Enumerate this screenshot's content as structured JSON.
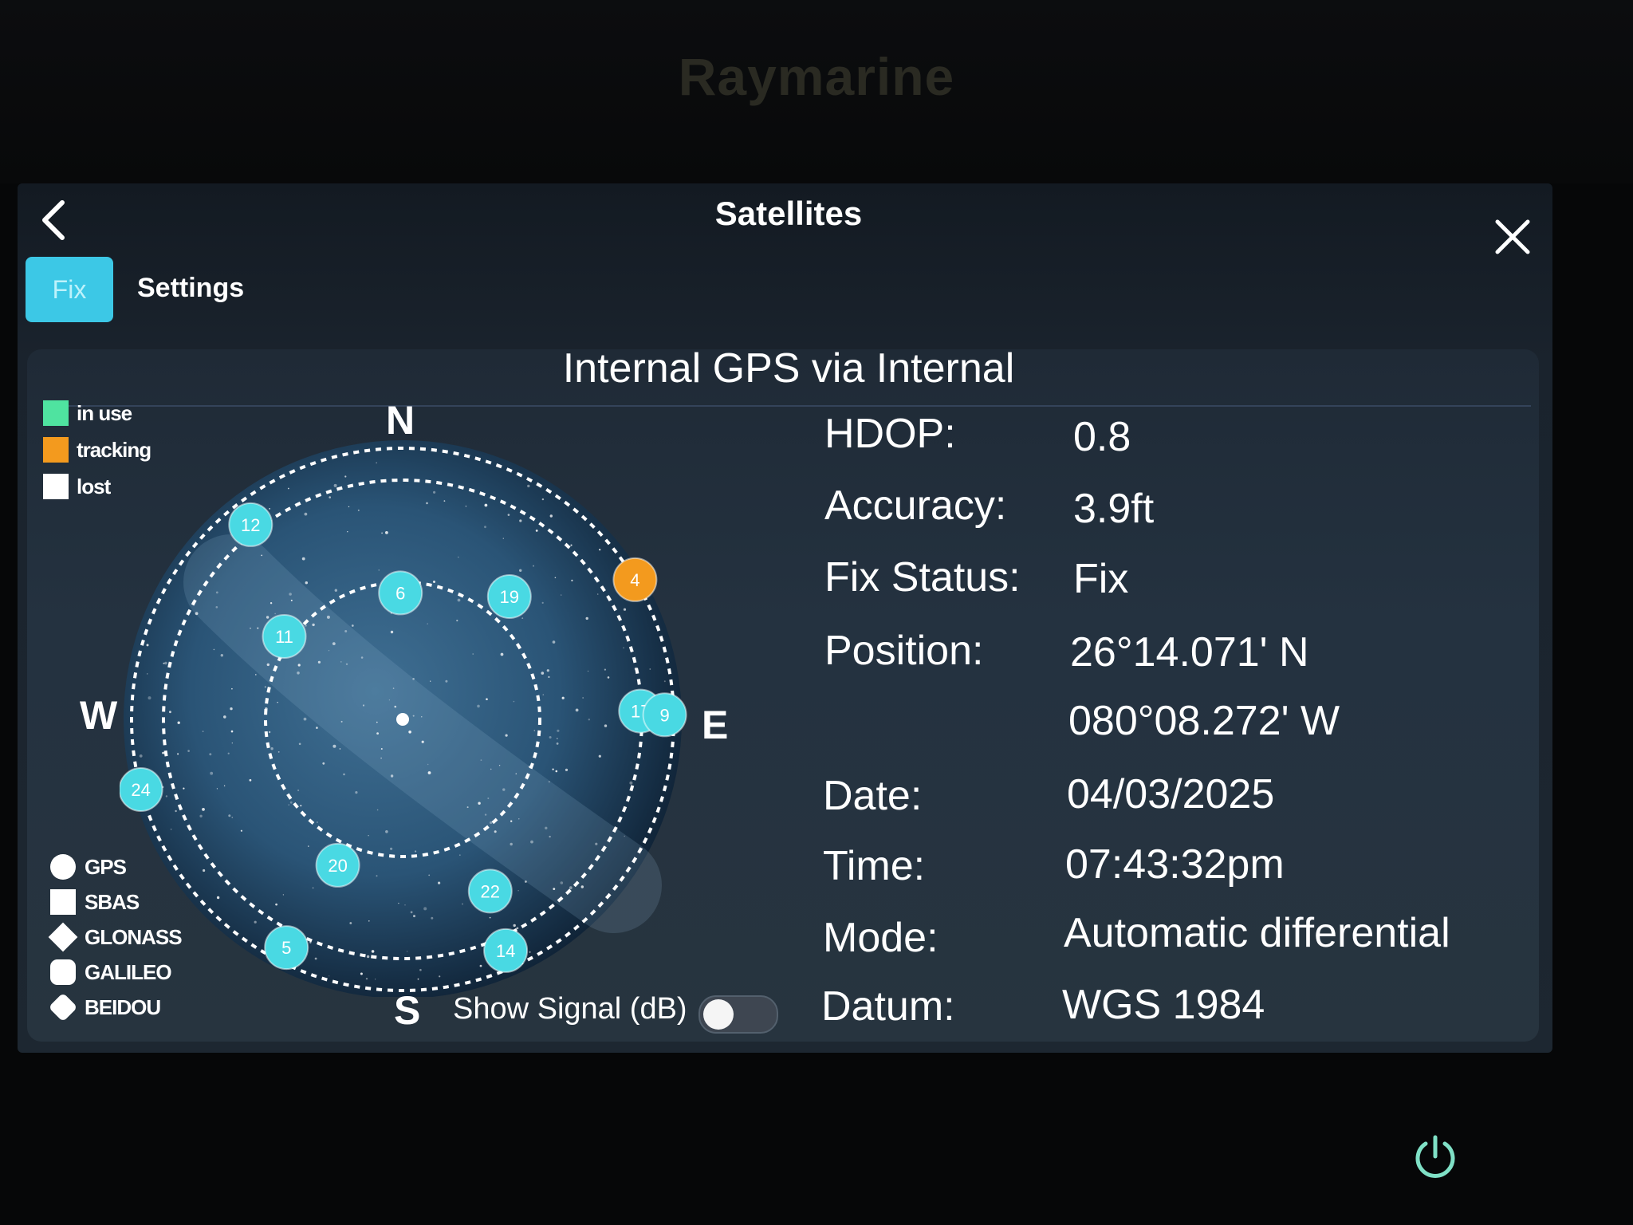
{
  "device": {
    "brand": "Raymarine"
  },
  "header": {
    "title": "Satellites"
  },
  "tabs": [
    {
      "label": "Fix",
      "active": true
    },
    {
      "label": "Settings",
      "active": false
    }
  ],
  "panel": {
    "title": "Internal GPS via Internal"
  },
  "legend": [
    {
      "label": "in use",
      "color": "#4fe3a0"
    },
    {
      "label": "tracking",
      "color": "#f39a1e"
    },
    {
      "label": "lost",
      "color": "#ffffff"
    }
  ],
  "compass": {
    "n": "N",
    "e": "E",
    "s": "S",
    "w": "W"
  },
  "satellites": [
    {
      "id": "12",
      "status": "in use",
      "color": "#49d9e3",
      "az": 322,
      "el": 8
    },
    {
      "id": "6",
      "status": "in use",
      "color": "#49d9e3",
      "az": 359,
      "el": 48
    },
    {
      "id": "4",
      "status": "tracking",
      "color": "#f39a1e",
      "az": 59,
      "el": 0
    },
    {
      "id": "19",
      "status": "in use",
      "color": "#49d9e3",
      "az": 41,
      "el": 36
    },
    {
      "id": "11",
      "status": "in use",
      "color": "#49d9e3",
      "az": 305,
      "el": 42
    },
    {
      "id": "17",
      "status": "in use",
      "color": "#49d9e3",
      "az": 88,
      "el": 11
    },
    {
      "id": "9",
      "status": "in use",
      "color": "#49d9e3",
      "az": 89,
      "el": 3
    },
    {
      "id": "24",
      "status": "in use",
      "color": "#49d9e3",
      "az": 255,
      "el": 0
    },
    {
      "id": "20",
      "status": "in use",
      "color": "#49d9e3",
      "az": 204,
      "el": 37
    },
    {
      "id": "22",
      "status": "in use",
      "color": "#49d9e3",
      "az": 153,
      "el": 26
    },
    {
      "id": "5",
      "status": "in use",
      "color": "#49d9e3",
      "az": 207,
      "el": 5
    },
    {
      "id": "14",
      "status": "in use",
      "color": "#49d9e3",
      "az": 156,
      "el": 6
    }
  ],
  "constellations": [
    {
      "label": "GPS",
      "shape": "circle"
    },
    {
      "label": "SBAS",
      "shape": "square"
    },
    {
      "label": "GLONASS",
      "shape": "diamond"
    },
    {
      "label": "GALILEO",
      "shape": "rounded-square"
    },
    {
      "label": "BEIDOU",
      "shape": "rounded-diamond"
    }
  ],
  "toggle": {
    "label": "Show Signal (dB)",
    "on": false
  },
  "info": {
    "hdop_label": "HDOP:",
    "hdop": "0.8",
    "accuracy_label": "Accuracy:",
    "accuracy": "3.9ft",
    "fix_label": "Fix Status:",
    "fix": "Fix",
    "position_label": "Position:",
    "lat": "26°14.071' N",
    "lon": "080°08.272' W",
    "date_label": "Date:",
    "date": "04/03/2025",
    "time_label": "Time:",
    "time": "07:43:32pm",
    "mode_label": "Mode:",
    "mode": "Automatic differential",
    "datum_label": "Datum:",
    "datum": "WGS 1984"
  }
}
